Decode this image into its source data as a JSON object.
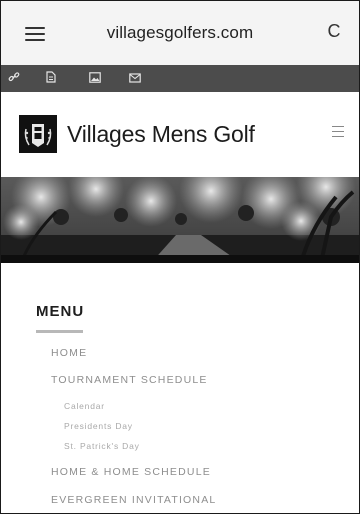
{
  "browser": {
    "url": "villagesgolfers.com",
    "menu_icon": "hamburger-icon",
    "reload_icon": "reload-icon",
    "reload_glyph": "C"
  },
  "toolbar": {
    "icons": [
      "link-icon",
      "file-icon",
      "image-icon",
      "mail-icon"
    ],
    "background": "#4c4c4c"
  },
  "site": {
    "title": "Villages Mens Golf",
    "logo_icon": "club-logo-icon",
    "menu_icon": "site-menu-icon"
  },
  "menu": {
    "heading": "MENU",
    "items": [
      {
        "label": "HOME",
        "level": 1
      },
      {
        "label": "TOURNAMENT SCHEDULE",
        "level": 1
      },
      {
        "label": "Calendar",
        "level": 2
      },
      {
        "label": "Presidents Day",
        "level": 2
      },
      {
        "label": "St. Patrick's Day",
        "level": 2
      },
      {
        "label": "HOME & HOME SCHEDULE",
        "level": 1
      },
      {
        "label": "EVERGREEN INVITATIONAL",
        "level": 1
      }
    ]
  }
}
